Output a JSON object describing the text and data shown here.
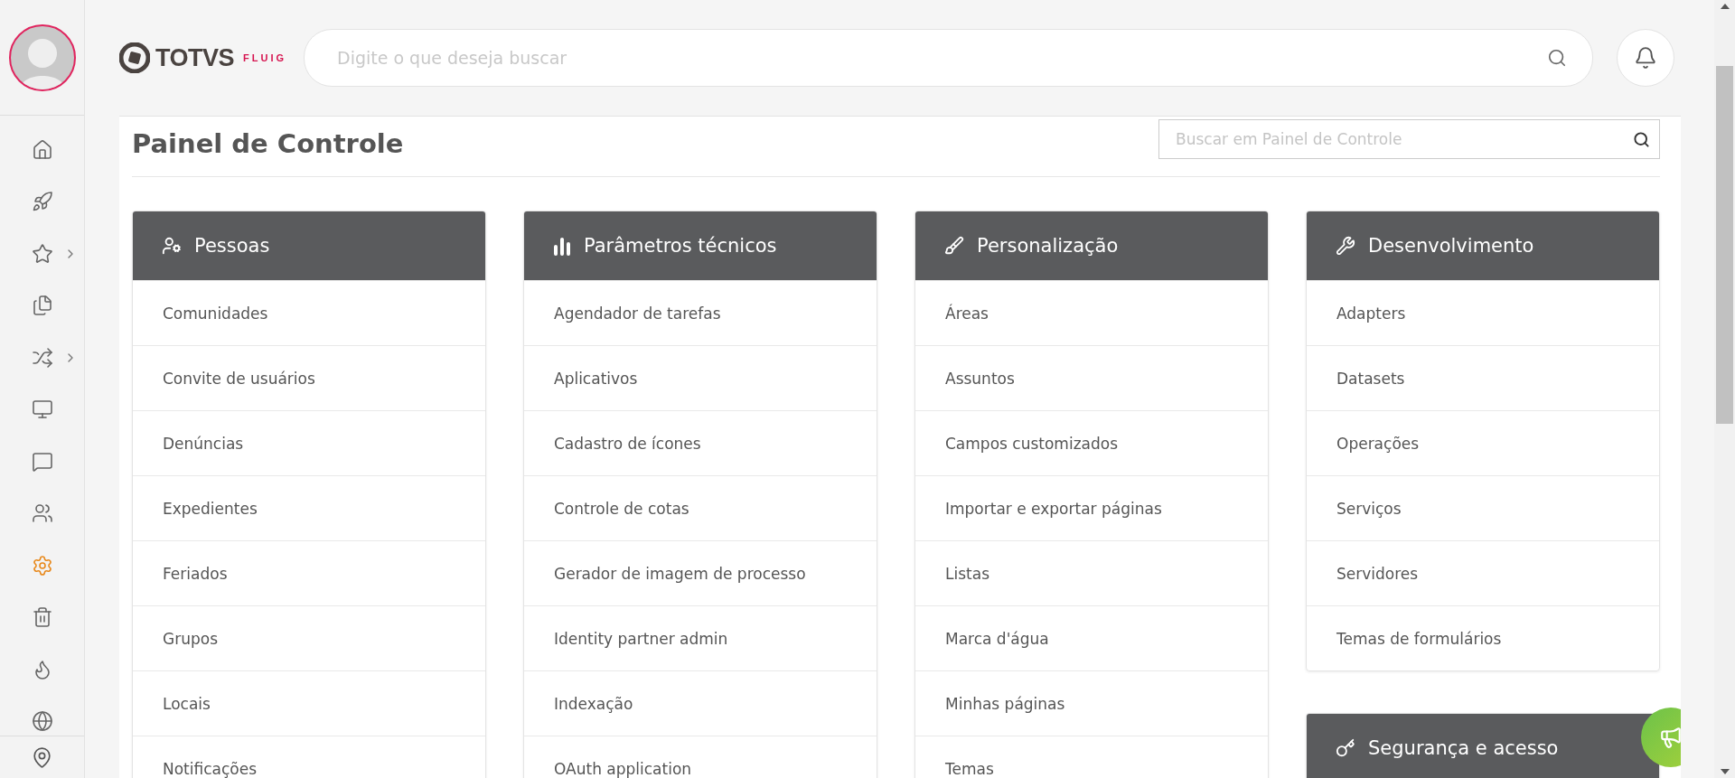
{
  "header": {
    "logo": {
      "brand": "TOTVS",
      "product": "FLUIG"
    },
    "search": {
      "placeholder": "Digite o que deseja buscar"
    }
  },
  "sidebar": {
    "items": [
      {
        "selected": false,
        "submenu": false
      },
      {
        "selected": false,
        "submenu": false
      },
      {
        "selected": false,
        "submenu": true
      },
      {
        "selected": false,
        "submenu": false
      },
      {
        "selected": false,
        "submenu": true
      },
      {
        "selected": false,
        "submenu": false
      },
      {
        "selected": false,
        "submenu": false
      },
      {
        "selected": false,
        "submenu": false
      },
      {
        "selected": true,
        "submenu": false
      },
      {
        "selected": false,
        "submenu": false
      },
      {
        "selected": false,
        "submenu": false
      },
      {
        "selected": false,
        "submenu": false
      }
    ]
  },
  "panel": {
    "title": "Painel de Controle",
    "search": {
      "placeholder": "Buscar em Painel de Controle"
    },
    "columns": [
      {
        "sections": [
          {
            "title": "Pessoas",
            "items": [
              "Comunidades",
              "Convite de usuários",
              "Denúncias",
              "Expedientes",
              "Feriados",
              "Grupos",
              "Locais",
              "Notificações"
            ]
          }
        ]
      },
      {
        "sections": [
          {
            "title": "Parâmetros técnicos",
            "items": [
              "Agendador de tarefas",
              "Aplicativos",
              "Cadastro de ícones",
              "Controle de cotas",
              "Gerador de imagem de processo",
              "Identity partner admin",
              "Indexação",
              "OAuth application"
            ]
          }
        ]
      },
      {
        "sections": [
          {
            "title": "Personalização",
            "items": [
              "Áreas",
              "Assuntos",
              "Campos customizados",
              "Importar e exportar páginas",
              "Listas",
              "Marca d'água",
              "Minhas páginas",
              "Temas"
            ]
          }
        ]
      },
      {
        "sections": [
          {
            "title": "Desenvolvimento",
            "items": [
              "Adapters",
              "Datasets",
              "Operações",
              "Serviços",
              "Servidores",
              "Temas de formulários"
            ]
          },
          {
            "title": "Segurança e acesso"
          }
        ]
      }
    ]
  }
}
